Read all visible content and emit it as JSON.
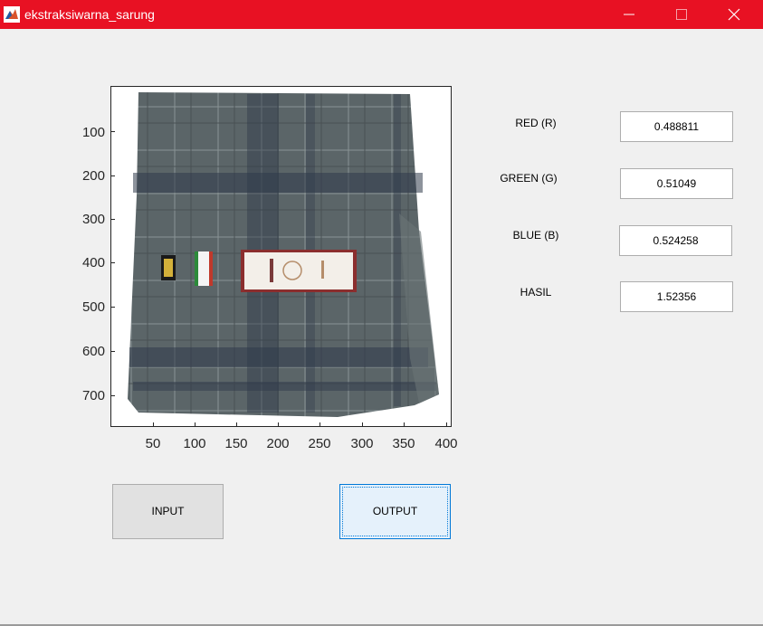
{
  "window": {
    "title": "ekstraksiwarna_sarung",
    "icon": "matlab-icon",
    "controls": [
      "minimize-icon",
      "maximize-icon",
      "close-icon"
    ],
    "accent_color": "#e81123"
  },
  "axes": {
    "image_content": "sarung-image",
    "y_ticks": [
      "100",
      "200",
      "300",
      "400",
      "500",
      "600",
      "700"
    ],
    "x_ticks": [
      "50",
      "100",
      "150",
      "200",
      "250",
      "300",
      "350",
      "400"
    ]
  },
  "results": {
    "red": {
      "label": "RED (R)",
      "value": "0.488811"
    },
    "green": {
      "label": "GREEN (G)",
      "value": "0.51049"
    },
    "blue": {
      "label": "BLUE (B)",
      "value": "0.524258"
    },
    "hasil": {
      "label": "HASIL",
      "value": "1.52356"
    }
  },
  "buttons": {
    "input_label": "INPUT",
    "output_label": "OUTPUT"
  }
}
